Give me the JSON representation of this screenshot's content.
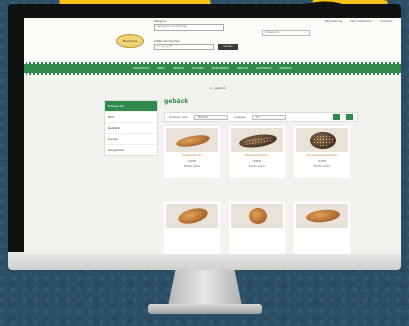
{
  "header": {
    "top_links": [
      "Registrierung",
      "Mein Lieferkonto",
      "Anmelden"
    ],
    "logo_text": "Backhaus",
    "search_label": "Kategorie",
    "search_value": "Kategorie durchsuchen",
    "keyword_label": "Artikel durchsuchen",
    "keyword_placeholder": "Suchbegriff",
    "search_button": "Suchen",
    "cart_value": "Warenkorb"
  },
  "nav": {
    "items": [
      "STARTSEITE",
      "BROT",
      "GEBÄCK",
      "KUCHEN",
      "FEINGEBÄCK",
      "SNACKS",
      "ANGEBOTE",
      "KONTAKT"
    ]
  },
  "breadcrumb": "⌂ / gebäck",
  "sidebar": {
    "title": "Kategorien",
    "items": [
      "Brot",
      "Gebäck",
      "Kuchen",
      "Feingebäck"
    ],
    "active_index": 1
  },
  "main": {
    "title": "gebäck",
    "sort_label": "Sortieren nach",
    "sort_value": "Position",
    "show_label": "Anzeigen",
    "show_value": "12"
  },
  "products": [
    {
      "name": "Dinkelbrötchen",
      "price": "0,60 €",
      "info": "Enthält: Gluten"
    },
    {
      "name": "Mehrkornbrötchen",
      "price": "0,65 €",
      "info": "Enthält: Gluten"
    },
    {
      "name": "Sonnenblumenbrötchen",
      "price": "0,70 €",
      "info": "Enthält: Gluten"
    },
    {
      "name": "",
      "price": "",
      "info": ""
    },
    {
      "name": "",
      "price": "",
      "info": ""
    },
    {
      "name": "",
      "price": "",
      "info": ""
    }
  ],
  "colors": {
    "brand_green": "#2f8a4c",
    "note_yellow": "#f6c21a",
    "backdrop": "#2b4f66"
  }
}
